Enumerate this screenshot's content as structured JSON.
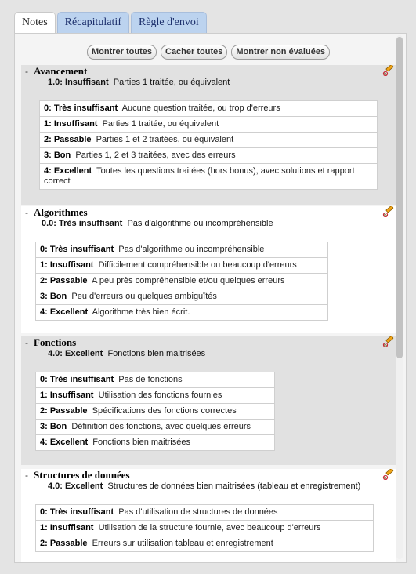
{
  "tabs": [
    {
      "label": "Notes"
    },
    {
      "label": "Récapitulatif"
    },
    {
      "label": "Règle d'envoi"
    }
  ],
  "buttons": {
    "show_all": "Montrer toutes",
    "hide_all": "Cacher toutes",
    "show_unrated": "Montrer non évaluées"
  },
  "criteria": [
    {
      "title": "Avancement",
      "current_level": "1.0: Insuffisant",
      "current_desc": "Parties 1 traitée, ou équivalent",
      "levels": [
        {
          "name": "0: Très insuffisant",
          "desc": "Aucune question traitée, ou trop d'erreurs"
        },
        {
          "name": "1: Insuffisant",
          "desc": "Parties 1 traitée, ou équivalent"
        },
        {
          "name": "2: Passable",
          "desc": "Parties 1 et 2 traitées, ou équivalent"
        },
        {
          "name": "3: Bon",
          "desc": "Parties 1, 2 et 3 traitées, avec des erreurs"
        },
        {
          "name": "4: Excellent",
          "desc": "Toutes les questions traitées (hors bonus), avec solutions et rapport correct"
        }
      ]
    },
    {
      "title": "Algorithmes",
      "current_level": "0.0: Très insuffisant",
      "current_desc": "Pas d'algorithme ou incompréhensible",
      "levels": [
        {
          "name": "0: Très insuffisant",
          "desc": "Pas d'algorithme ou incompréhensible"
        },
        {
          "name": "1: Insuffisant",
          "desc": "Difficilement compréhensible ou beaucoup d'erreurs"
        },
        {
          "name": "2: Passable",
          "desc": "A peu près compréhensible et/ou quelques erreurs"
        },
        {
          "name": "3: Bon",
          "desc": "Peu d'erreurs ou quelques ambiguïtés"
        },
        {
          "name": "4: Excellent",
          "desc": "Algorithme très bien écrit."
        }
      ]
    },
    {
      "title": "Fonctions",
      "current_level": "4.0: Excellent",
      "current_desc": "Fonctions bien maitrisées",
      "levels": [
        {
          "name": "0: Très insuffisant",
          "desc": "Pas de fonctions"
        },
        {
          "name": "1: Insuffisant",
          "desc": "Utilisation des fonctions fournies"
        },
        {
          "name": "2: Passable",
          "desc": "Spécifications des fonctions correctes"
        },
        {
          "name": "3: Bon",
          "desc": "Définition des fonctions, avec quelques erreurs"
        },
        {
          "name": "4: Excellent",
          "desc": "Fonctions bien maitrisées"
        }
      ]
    },
    {
      "title": "Structures de données",
      "current_level": "4.0: Excellent",
      "current_desc": "Structures de données bien maitrisées (tableau et enregistrement)",
      "levels": [
        {
          "name": "0: Très insuffisant",
          "desc": "Pas d'utilisation de structures de données"
        },
        {
          "name": "1: Insuffisant",
          "desc": "Utilisation de la structure fournie, avec beaucoup d'erreurs"
        },
        {
          "name": "2: Passable",
          "desc": "Erreurs sur utilisation tableau et enregistrement"
        }
      ]
    }
  ]
}
